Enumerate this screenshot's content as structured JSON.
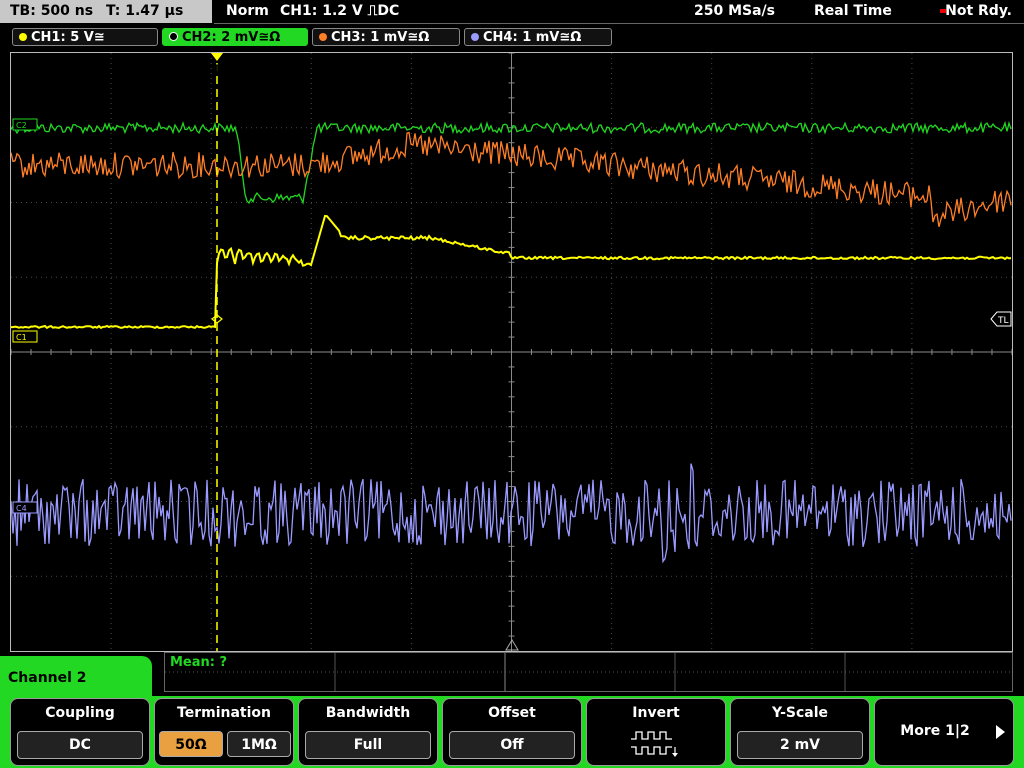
{
  "topbar": {
    "timebase": "TB: 500 ns",
    "trigger_time": "T: 1.47 µs",
    "trigger_mode": "Norm",
    "trigger_info": "CH1: 1.2 V ⎍DC",
    "sample_rate": "250 MSa/s",
    "acq_mode": "Real Time",
    "status": "Not Rdy."
  },
  "channels": [
    {
      "label": "CH1: 5 V≅",
      "color": "#ffff00"
    },
    {
      "label": "CH2: 2 mV≅Ω",
      "color": "#22d822"
    },
    {
      "label": "CH3: 1 mV≅Ω",
      "color": "#ff7f27"
    },
    {
      "label": "CH4: 1 mV≅Ω",
      "color": "#9a9aff"
    }
  ],
  "screen": {
    "ch1_marker": "C1",
    "ch2_marker": "C2",
    "ch4_marker": "C4",
    "trigger_level_marker": "TL",
    "trigger_pos_marker": "T"
  },
  "measurement": {
    "label": "Mean: ?"
  },
  "menu": {
    "title": "Channel 2",
    "coupling": {
      "title": "Coupling",
      "value": "DC"
    },
    "termination": {
      "title": "Termination",
      "opt_50": "50Ω",
      "opt_1m": "1MΩ",
      "selected": "50Ω"
    },
    "bandwidth": {
      "title": "Bandwidth",
      "value": "Full"
    },
    "offset": {
      "title": "Offset",
      "value": "Off"
    },
    "invert": {
      "title": "Invert",
      "icon": "invert-waveform-icon"
    },
    "yscale": {
      "title": "Y-Scale",
      "value": "2 mV"
    },
    "more": {
      "label": "More 1|2"
    }
  },
  "colors": {
    "accent_green": "#22d822",
    "termination_selected": "#e8a040"
  }
}
